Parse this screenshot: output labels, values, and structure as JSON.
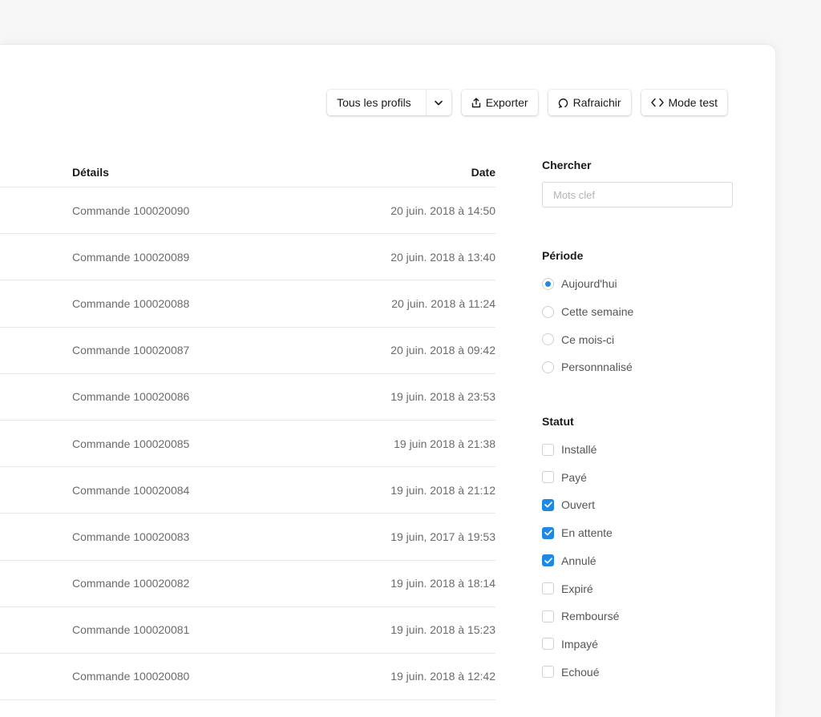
{
  "toolbar": {
    "profiles_label": "Tous les profils",
    "export_label": "Exporter",
    "refresh_label": "Rafraichir",
    "testmode_label": "Mode test"
  },
  "table": {
    "headers": {
      "details": "Détails",
      "date": "Date"
    },
    "rows": [
      {
        "details": "Commande 100020090",
        "date": "20 juin. 2018 à 14:50"
      },
      {
        "details": "Commande 100020089",
        "date": "20 juin. 2018 à 13:40"
      },
      {
        "details": "Commande 100020088",
        "date": "20 juin. 2018 à 11:24"
      },
      {
        "details": "Commande 100020087",
        "date": "20 juin. 2018 à 09:42"
      },
      {
        "details": "Commande 100020086",
        "date": "19 juin. 2018 à 23:53"
      },
      {
        "details": "Commande 100020085",
        "date": "19 juin 2018 à 21:38"
      },
      {
        "details": "Commande 100020084",
        "date": "19 juin. 2018 à 21:12"
      },
      {
        "details": "Commande 100020083",
        "date": "19 juin, 2017 à 19:53"
      },
      {
        "details": "Commande 100020082",
        "date": "19 juin. 2018 à 18:14"
      },
      {
        "details": "Commande 100020081",
        "date": "19 juin. 2018 à 15:23"
      },
      {
        "details": "Commande 100020080",
        "date": "19 juin. 2018 à 12:42"
      }
    ]
  },
  "sidebar": {
    "search": {
      "title": "Chercher",
      "placeholder": "Mots clef",
      "value": ""
    },
    "period": {
      "title": "Période",
      "options": [
        {
          "label": "Aujourd'hui",
          "selected": true
        },
        {
          "label": "Cette semaine",
          "selected": false
        },
        {
          "label": "Ce mois-ci",
          "selected": false
        },
        {
          "label": "Personnnalisé",
          "selected": false
        }
      ]
    },
    "status": {
      "title": "Statut",
      "options": [
        {
          "label": "Installé",
          "checked": false
        },
        {
          "label": "Payé",
          "checked": false
        },
        {
          "label": "Ouvert",
          "checked": true
        },
        {
          "label": "En attente",
          "checked": true
        },
        {
          "label": "Annulé",
          "checked": true
        },
        {
          "label": "Expiré",
          "checked": false
        },
        {
          "label": "Remboursé",
          "checked": false
        },
        {
          "label": "Impayé",
          "checked": false
        },
        {
          "label": "Echoué",
          "checked": false
        }
      ]
    }
  },
  "colors": {
    "accent": "#1e88e5",
    "page_bg": "#f7f7f7",
    "card_bg": "#ffffff"
  },
  "icons": {
    "profiles_caret": "chevron-down-icon",
    "export": "export-icon",
    "refresh": "refresh-icon",
    "testmode": "code-icon"
  }
}
